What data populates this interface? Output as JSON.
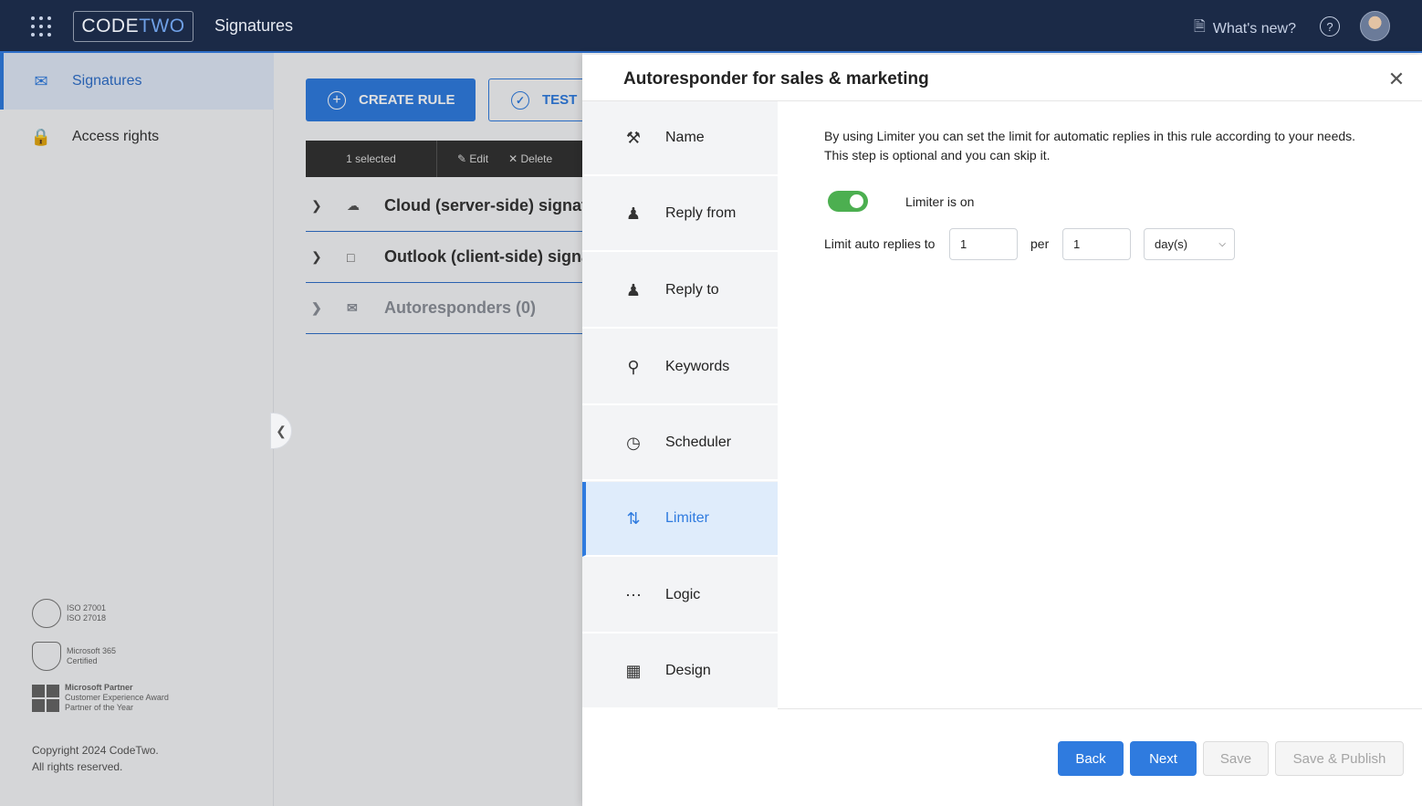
{
  "topbar": {
    "logo_code": "CODE",
    "logo_two": "TWO",
    "app_title": "Signatures",
    "whats_new": "What's new?",
    "help": "?"
  },
  "sidebar": {
    "items": [
      {
        "label": "Signatures",
        "icon": "signature-icon",
        "active": true
      },
      {
        "label": "Access rights",
        "icon": "lock-icon",
        "active": false
      }
    ],
    "certs": [
      {
        "lines": [
          "ISO 27001",
          "ISO 27018"
        ]
      },
      {
        "lines": [
          "Microsoft 365",
          "Certified"
        ]
      },
      {
        "lines": [
          "Microsoft Partner",
          "Customer Experience Award",
          "Partner of the Year"
        ]
      }
    ],
    "copyright": [
      "Copyright 2024 CodeTwo.",
      "All rights reserved."
    ]
  },
  "main": {
    "create_rule": "CREATE RULE",
    "test": "TEST",
    "selection": {
      "count": "1 selected",
      "edit": "Edit",
      "delete": "Delete"
    },
    "groups": [
      {
        "label": "Cloud (server-side) signatures",
        "icon": "cloud-icon"
      },
      {
        "label": "Outlook (client-side) signatures",
        "icon": "monitor-icon"
      },
      {
        "label": "Autoresponders (0)",
        "icon": "autoresponder-icon"
      }
    ]
  },
  "dialog": {
    "title": "Autoresponder for sales & marketing",
    "steps": [
      {
        "label": "Name",
        "icon": "signpost-icon"
      },
      {
        "label": "Reply from",
        "icon": "users-arrow-icon"
      },
      {
        "label": "Reply to",
        "icon": "users-in-icon"
      },
      {
        "label": "Keywords",
        "icon": "keyword-search-icon"
      },
      {
        "label": "Scheduler",
        "icon": "clock-icon"
      },
      {
        "label": "Limiter",
        "icon": "limiter-icon",
        "active": true
      },
      {
        "label": "Logic",
        "icon": "logic-icon"
      },
      {
        "label": "Design",
        "icon": "design-icon"
      }
    ],
    "limiter": {
      "description_line1": "By using Limiter you can set the limit for automatic replies in this rule according to your needs.",
      "description_line2": "This step is optional and you can skip it.",
      "toggle_on": true,
      "toggle_label": "Limiter is on",
      "limit_label": "Limit auto replies to",
      "count_value": "1",
      "per_label": "per",
      "period_value": "1",
      "unit_value": "day(s)"
    },
    "buttons": {
      "back": "Back",
      "next": "Next",
      "save": "Save",
      "save_publish": "Save & Publish"
    }
  },
  "colors": {
    "accent": "#2f7bdf",
    "topbar": "#1b2a47",
    "toggle_on": "#4caf50"
  }
}
